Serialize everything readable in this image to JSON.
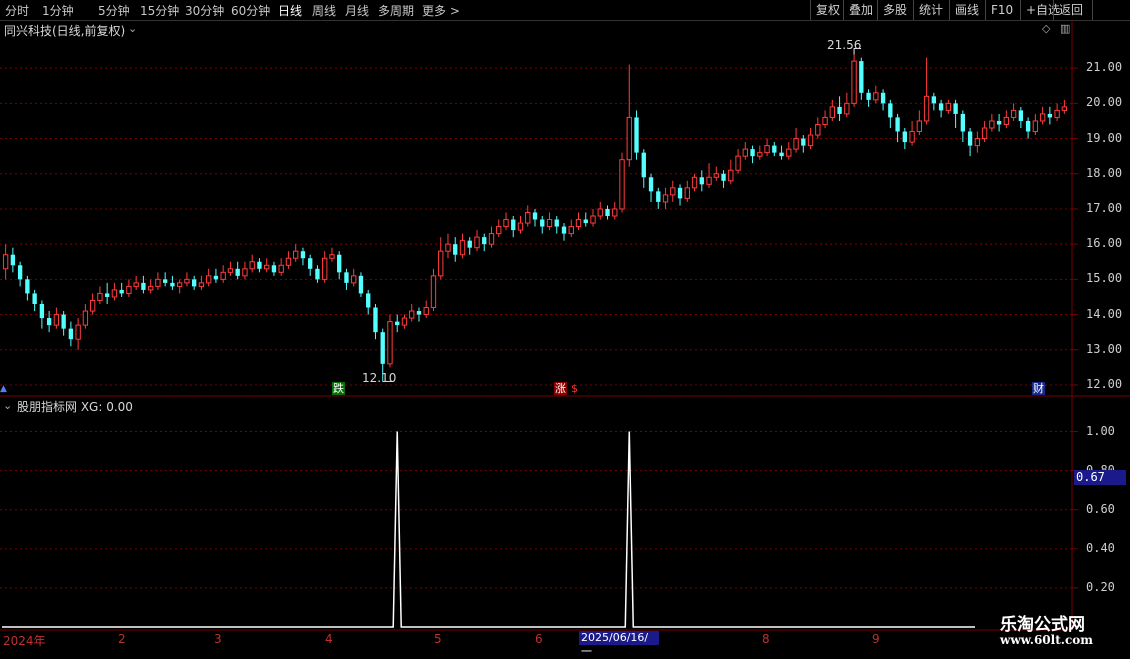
{
  "toolbar": {
    "periods": [
      "分时",
      "1分钟",
      "5分钟",
      "15分钟",
      "30分钟",
      "60分钟",
      "日线",
      "周线",
      "月线",
      "多周期",
      "更多 >"
    ],
    "active_period": "日线",
    "right_buttons": [
      "复权",
      "叠加",
      "多股",
      "统计",
      "画线",
      "F10",
      "+自选",
      "返回"
    ]
  },
  "chart": {
    "title": "同兴科技(日线,前复权)",
    "high_marker": "21.56",
    "low_marker": "12.10",
    "events": [
      {
        "label": "跌",
        "bg": "#0a6e0a",
        "fg": "#ffffff"
      },
      {
        "label": "涨",
        "bg": "#8a0000",
        "fg": "#ffffff"
      },
      {
        "label": "$",
        "bg": "#000000",
        "fg": "#ff3030"
      },
      {
        "label": "财",
        "bg": "#1a2a8a",
        "fg": "#ffffff"
      }
    ],
    "y_ticks": [
      "21.00",
      "20.00",
      "19.00",
      "18.00",
      "17.00",
      "16.00",
      "15.00",
      "14.00",
      "13.00",
      "12.00"
    ]
  },
  "indicator": {
    "title": "股朋指标网 XG: 0.00",
    "y_ticks": [
      "1.00",
      "0.80",
      "0.60",
      "0.40",
      "0.20"
    ],
    "cursor_value": "0.67"
  },
  "x_axis": {
    "labels": [
      "2024年",
      "2",
      "3",
      "4",
      "5",
      "6",
      "2025/06/16/一",
      "8",
      "9"
    ]
  },
  "watermark": {
    "title": "乐淘公式网",
    "url": "www.60lt.com"
  },
  "colors": {
    "up": "#ff3c3c",
    "down": "#54ffff",
    "grid": "#7a0000",
    "cursor": "#1a1a8a"
  },
  "chart_data": {
    "type": "candlestick",
    "y_range": [
      11.8,
      21.8
    ],
    "candles": [
      [
        15.3,
        15.7,
        16.0,
        15.0
      ],
      [
        15.7,
        15.4,
        15.9,
        15.2
      ],
      [
        15.4,
        15.0,
        15.5,
        14.8
      ],
      [
        15.0,
        14.6,
        15.1,
        14.4
      ],
      [
        14.6,
        14.3,
        14.7,
        14.1
      ],
      [
        14.3,
        13.9,
        14.4,
        13.6
      ],
      [
        13.9,
        13.7,
        14.1,
        13.5
      ],
      [
        13.7,
        14.0,
        14.2,
        13.6
      ],
      [
        14.0,
        13.6,
        14.1,
        13.4
      ],
      [
        13.6,
        13.3,
        13.8,
        13.1
      ],
      [
        13.3,
        13.7,
        13.9,
        13.0
      ],
      [
        13.7,
        14.1,
        14.3,
        13.6
      ],
      [
        14.1,
        14.4,
        14.6,
        14.0
      ],
      [
        14.4,
        14.6,
        14.8,
        14.3
      ],
      [
        14.6,
        14.5,
        14.9,
        14.3
      ],
      [
        14.5,
        14.7,
        14.9,
        14.4
      ],
      [
        14.7,
        14.6,
        14.9,
        14.5
      ],
      [
        14.6,
        14.8,
        15.0,
        14.5
      ],
      [
        14.8,
        14.9,
        15.1,
        14.7
      ],
      [
        14.9,
        14.7,
        15.1,
        14.6
      ],
      [
        14.7,
        14.8,
        15.0,
        14.6
      ],
      [
        14.8,
        15.0,
        15.2,
        14.7
      ],
      [
        15.0,
        14.9,
        15.2,
        14.8
      ],
      [
        14.9,
        14.8,
        15.1,
        14.7
      ],
      [
        14.8,
        14.9,
        15.0,
        14.6
      ],
      [
        14.9,
        15.0,
        15.2,
        14.8
      ],
      [
        15.0,
        14.8,
        15.1,
        14.7
      ],
      [
        14.8,
        14.9,
        15.1,
        14.7
      ],
      [
        14.9,
        15.1,
        15.3,
        14.8
      ],
      [
        15.1,
        15.0,
        15.3,
        14.9
      ],
      [
        15.0,
        15.2,
        15.4,
        14.9
      ],
      [
        15.2,
        15.3,
        15.5,
        15.1
      ],
      [
        15.3,
        15.1,
        15.5,
        15.0
      ],
      [
        15.1,
        15.3,
        15.5,
        15.0
      ],
      [
        15.3,
        15.5,
        15.7,
        15.2
      ],
      [
        15.5,
        15.3,
        15.6,
        15.2
      ],
      [
        15.3,
        15.4,
        15.6,
        15.2
      ],
      [
        15.4,
        15.2,
        15.5,
        15.1
      ],
      [
        15.2,
        15.4,
        15.6,
        15.1
      ],
      [
        15.4,
        15.6,
        15.8,
        15.3
      ],
      [
        15.6,
        15.8,
        16.0,
        15.5
      ],
      [
        15.8,
        15.6,
        15.9,
        15.4
      ],
      [
        15.6,
        15.3,
        15.7,
        15.1
      ],
      [
        15.3,
        15.0,
        15.4,
        14.9
      ],
      [
        15.0,
        15.6,
        15.8,
        14.9
      ],
      [
        15.6,
        15.7,
        15.9,
        15.5
      ],
      [
        15.7,
        15.2,
        15.8,
        15.0
      ],
      [
        15.2,
        14.9,
        15.3,
        14.7
      ],
      [
        14.9,
        15.1,
        15.3,
        14.8
      ],
      [
        15.1,
        14.6,
        15.2,
        14.5
      ],
      [
        14.6,
        14.2,
        14.7,
        14.0
      ],
      [
        14.2,
        13.5,
        14.3,
        13.3
      ],
      [
        13.5,
        12.6,
        13.6,
        12.1
      ],
      [
        12.6,
        13.8,
        14.0,
        12.5
      ],
      [
        13.8,
        13.7,
        14.0,
        13.5
      ],
      [
        13.7,
        13.9,
        14.0,
        13.6
      ],
      [
        13.9,
        14.1,
        14.3,
        13.8
      ],
      [
        14.1,
        14.0,
        14.2,
        13.8
      ],
      [
        14.0,
        14.2,
        14.4,
        13.9
      ],
      [
        14.2,
        15.1,
        15.3,
        14.1
      ],
      [
        15.1,
        15.8,
        16.2,
        15.0
      ],
      [
        15.8,
        16.0,
        16.3,
        15.6
      ],
      [
        16.0,
        15.7,
        16.2,
        15.5
      ],
      [
        15.7,
        16.1,
        16.3,
        15.6
      ],
      [
        16.1,
        15.9,
        16.2,
        15.7
      ],
      [
        15.9,
        16.2,
        16.4,
        15.8
      ],
      [
        16.2,
        16.0,
        16.3,
        15.8
      ],
      [
        16.0,
        16.3,
        16.5,
        15.9
      ],
      [
        16.3,
        16.5,
        16.7,
        16.2
      ],
      [
        16.5,
        16.7,
        16.9,
        16.4
      ],
      [
        16.7,
        16.4,
        16.8,
        16.2
      ],
      [
        16.4,
        16.6,
        16.8,
        16.3
      ],
      [
        16.6,
        16.9,
        17.1,
        16.5
      ],
      [
        16.9,
        16.7,
        17.0,
        16.5
      ],
      [
        16.7,
        16.5,
        16.8,
        16.3
      ],
      [
        16.5,
        16.7,
        16.9,
        16.4
      ],
      [
        16.7,
        16.5,
        16.8,
        16.3
      ],
      [
        16.5,
        16.3,
        16.6,
        16.1
      ],
      [
        16.3,
        16.5,
        16.7,
        16.2
      ],
      [
        16.5,
        16.7,
        16.9,
        16.4
      ],
      [
        16.7,
        16.6,
        16.9,
        16.5
      ],
      [
        16.6,
        16.8,
        17.0,
        16.5
      ],
      [
        16.8,
        17.0,
        17.2,
        16.7
      ],
      [
        17.0,
        16.8,
        17.1,
        16.7
      ],
      [
        16.8,
        17.0,
        17.2,
        16.7
      ],
      [
        17.0,
        18.4,
        18.6,
        16.9
      ],
      [
        18.4,
        19.6,
        21.1,
        18.2
      ],
      [
        19.6,
        18.6,
        19.8,
        18.4
      ],
      [
        18.6,
        17.9,
        18.7,
        17.6
      ],
      [
        17.9,
        17.5,
        18.0,
        17.2
      ],
      [
        17.5,
        17.2,
        17.6,
        17.0
      ],
      [
        17.2,
        17.4,
        17.6,
        17.0
      ],
      [
        17.4,
        17.6,
        17.8,
        17.2
      ],
      [
        17.6,
        17.3,
        17.7,
        17.1
      ],
      [
        17.3,
        17.6,
        17.8,
        17.2
      ],
      [
        17.6,
        17.9,
        18.0,
        17.5
      ],
      [
        17.9,
        17.7,
        18.1,
        17.5
      ],
      [
        17.7,
        17.9,
        18.3,
        17.6
      ],
      [
        17.9,
        18.0,
        18.2,
        17.8
      ],
      [
        18.0,
        17.8,
        18.1,
        17.6
      ],
      [
        17.8,
        18.1,
        18.4,
        17.7
      ],
      [
        18.1,
        18.5,
        18.7,
        18.0
      ],
      [
        18.5,
        18.7,
        18.9,
        18.4
      ],
      [
        18.7,
        18.5,
        18.8,
        18.3
      ],
      [
        18.5,
        18.6,
        18.8,
        18.4
      ],
      [
        18.6,
        18.8,
        19.0,
        18.5
      ],
      [
        18.8,
        18.6,
        18.9,
        18.5
      ],
      [
        18.6,
        18.5,
        18.8,
        18.4
      ],
      [
        18.5,
        18.7,
        18.9,
        18.4
      ],
      [
        18.7,
        19.0,
        19.3,
        18.6
      ],
      [
        19.0,
        18.8,
        19.1,
        18.6
      ],
      [
        18.8,
        19.1,
        19.3,
        18.7
      ],
      [
        19.1,
        19.4,
        19.6,
        19.0
      ],
      [
        19.4,
        19.6,
        19.8,
        19.3
      ],
      [
        19.6,
        19.9,
        20.1,
        19.5
      ],
      [
        19.9,
        19.7,
        20.2,
        19.5
      ],
      [
        19.7,
        20.0,
        20.3,
        19.6
      ],
      [
        20.0,
        21.2,
        21.56,
        19.9
      ],
      [
        21.2,
        20.3,
        21.3,
        20.1
      ],
      [
        20.3,
        20.1,
        20.4,
        19.9
      ],
      [
        20.1,
        20.3,
        20.5,
        20.0
      ],
      [
        20.3,
        20.0,
        20.4,
        19.8
      ],
      [
        20.0,
        19.6,
        20.1,
        19.3
      ],
      [
        19.6,
        19.2,
        19.7,
        18.9
      ],
      [
        19.2,
        18.9,
        19.3,
        18.7
      ],
      [
        18.9,
        19.2,
        19.5,
        18.8
      ],
      [
        19.2,
        19.5,
        19.8,
        19.1
      ],
      [
        19.5,
        20.2,
        21.3,
        19.4
      ],
      [
        20.2,
        20.0,
        20.3,
        19.8
      ],
      [
        20.0,
        19.8,
        20.1,
        19.6
      ],
      [
        19.8,
        20.0,
        20.1,
        19.7
      ],
      [
        20.0,
        19.7,
        20.1,
        19.3
      ],
      [
        19.7,
        19.2,
        19.8,
        18.9
      ],
      [
        19.2,
        18.8,
        19.3,
        18.5
      ],
      [
        18.8,
        19.0,
        19.2,
        18.6
      ],
      [
        19.0,
        19.3,
        19.5,
        18.9
      ],
      [
        19.3,
        19.5,
        19.7,
        19.2
      ],
      [
        19.5,
        19.4,
        19.7,
        19.2
      ],
      [
        19.4,
        19.6,
        19.8,
        19.3
      ],
      [
        19.6,
        19.8,
        20.0,
        19.5
      ],
      [
        19.8,
        19.5,
        19.9,
        19.3
      ],
      [
        19.5,
        19.2,
        19.6,
        19.0
      ],
      [
        19.2,
        19.5,
        19.7,
        19.1
      ],
      [
        19.5,
        19.7,
        19.9,
        19.4
      ],
      [
        19.7,
        19.6,
        19.9,
        19.4
      ],
      [
        19.6,
        19.8,
        20.0,
        19.5
      ],
      [
        19.8,
        19.9,
        20.1,
        19.7
      ]
    ],
    "signal": {
      "spikes_at_index": [
        54,
        86
      ],
      "value": 1.0,
      "baseline": 0.0
    },
    "indicator_range": [
      0,
      1.1
    ]
  }
}
